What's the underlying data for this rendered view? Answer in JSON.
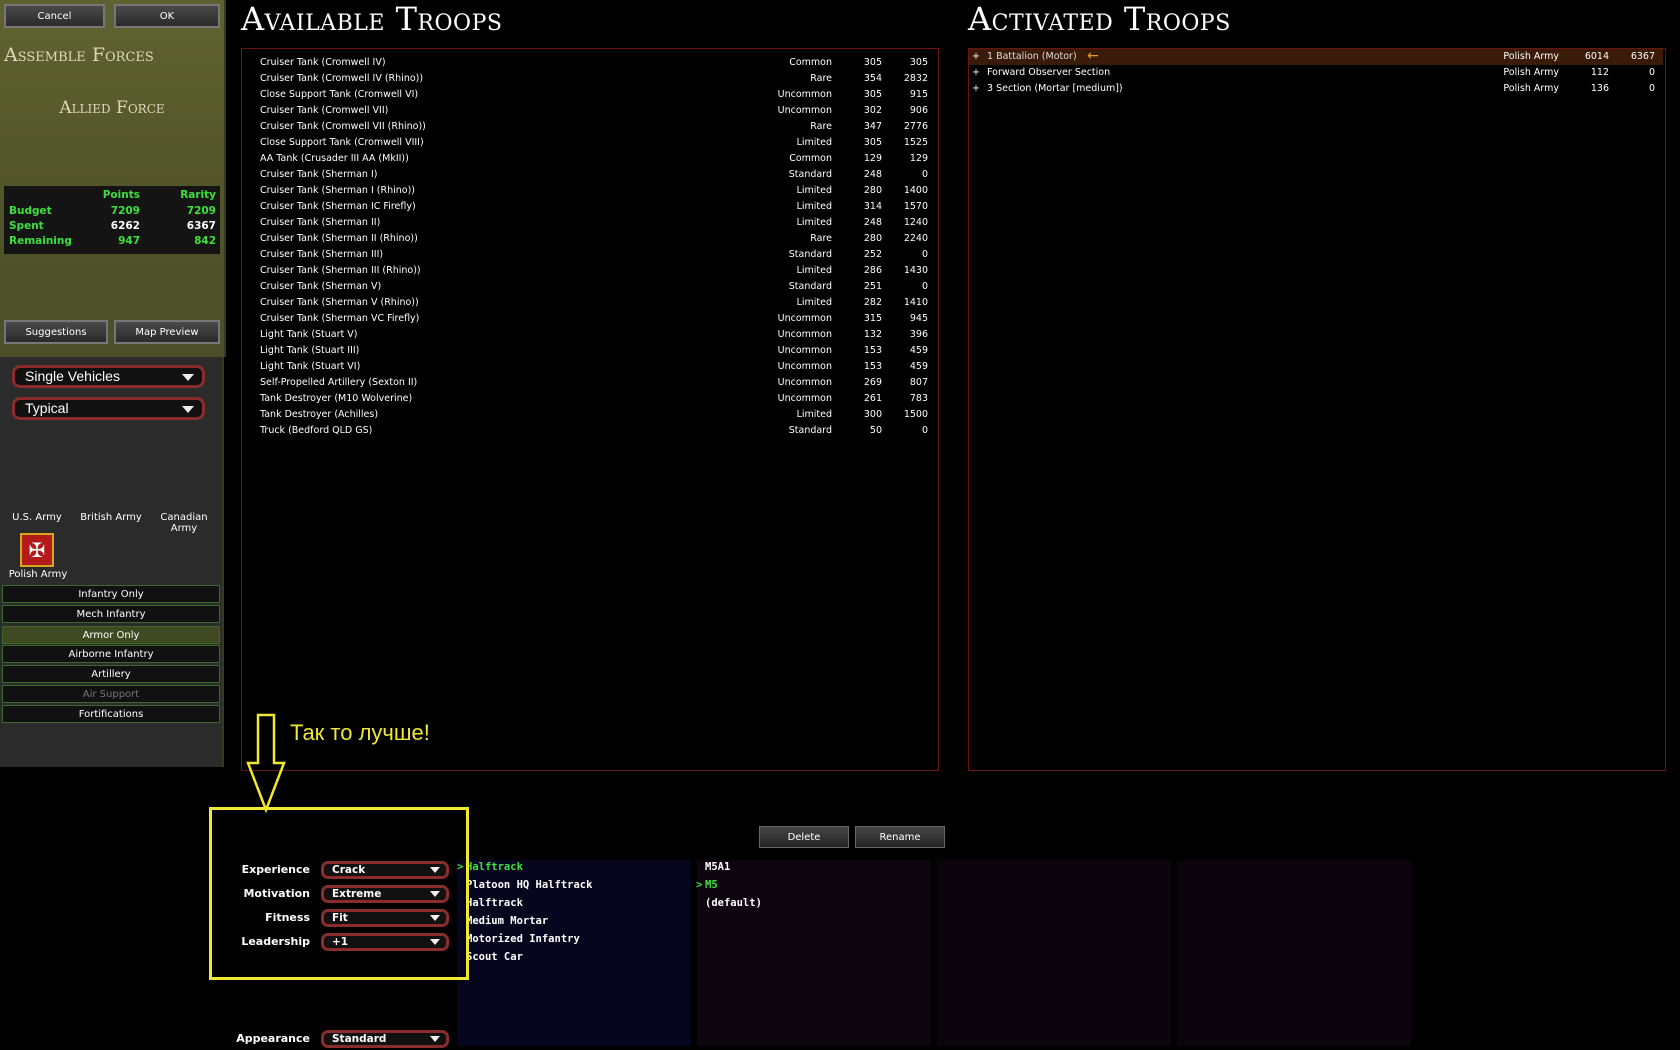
{
  "left": {
    "cancel_label": "Cancel",
    "ok_label": "OK",
    "title": "Assemble Forces",
    "force": "Allied Force",
    "budget": {
      "col_points": "Points",
      "col_rarity": "Rarity",
      "rows": [
        {
          "label": "Budget",
          "points": "7209",
          "rarity": "7209"
        },
        {
          "label": "Spent",
          "points": "6262",
          "rarity": "6367"
        },
        {
          "label": "Remaining",
          "points": "947",
          "rarity": "842"
        }
      ]
    },
    "suggestions_label": "Suggestions",
    "map_preview_label": "Map Preview",
    "purchase_type": "Single Vehicles",
    "quality": "Typical",
    "nations": [
      "U.S. Army",
      "British Army",
      "Canadian Army",
      "Polish Army"
    ],
    "filters": [
      "Infantry Only",
      "Mech Infantry",
      "Armor Only",
      "Airborne Infantry",
      "Artillery",
      "Air Support",
      "Fortifications"
    ]
  },
  "available": {
    "title": "Available Troops",
    "rows": [
      {
        "name": "Cruiser Tank (Cromwell IV)",
        "rarity": "Common",
        "cost": "305",
        "rcost": "305"
      },
      {
        "name": "Cruiser Tank (Cromwell IV (Rhino))",
        "rarity": "Rare",
        "cost": "354",
        "rcost": "2832"
      },
      {
        "name": "Close Support Tank (Cromwell VI)",
        "rarity": "Uncommon",
        "cost": "305",
        "rcost": "915"
      },
      {
        "name": "Cruiser Tank (Cromwell VII)",
        "rarity": "Uncommon",
        "cost": "302",
        "rcost": "906"
      },
      {
        "name": "Cruiser Tank (Cromwell VII (Rhino))",
        "rarity": "Rare",
        "cost": "347",
        "rcost": "2776"
      },
      {
        "name": "Close Support Tank (Cromwell VIII)",
        "rarity": "Limited",
        "cost": "305",
        "rcost": "1525"
      },
      {
        "name": "AA Tank (Crusader III AA (MkII))",
        "rarity": "Common",
        "cost": "129",
        "rcost": "129"
      },
      {
        "name": "Cruiser Tank (Sherman I)",
        "rarity": "Standard",
        "cost": "248",
        "rcost": "0"
      },
      {
        "name": "Cruiser Tank (Sherman I (Rhino))",
        "rarity": "Limited",
        "cost": "280",
        "rcost": "1400"
      },
      {
        "name": "Cruiser Tank (Sherman IC Firefly)",
        "rarity": "Limited",
        "cost": "314",
        "rcost": "1570"
      },
      {
        "name": "Cruiser Tank (Sherman II)",
        "rarity": "Limited",
        "cost": "248",
        "rcost": "1240"
      },
      {
        "name": "Cruiser Tank (Sherman II (Rhino))",
        "rarity": "Rare",
        "cost": "280",
        "rcost": "2240"
      },
      {
        "name": "Cruiser Tank (Sherman III)",
        "rarity": "Standard",
        "cost": "252",
        "rcost": "0"
      },
      {
        "name": "Cruiser Tank (Sherman III (Rhino))",
        "rarity": "Limited",
        "cost": "286",
        "rcost": "1430"
      },
      {
        "name": "Cruiser Tank (Sherman V)",
        "rarity": "Standard",
        "cost": "251",
        "rcost": "0"
      },
      {
        "name": "Cruiser Tank (Sherman V (Rhino))",
        "rarity": "Limited",
        "cost": "282",
        "rcost": "1410"
      },
      {
        "name": "Cruiser Tank (Sherman VC Firefly)",
        "rarity": "Uncommon",
        "cost": "315",
        "rcost": "945"
      },
      {
        "name": "Light Tank (Stuart V)",
        "rarity": "Uncommon",
        "cost": "132",
        "rcost": "396"
      },
      {
        "name": "Light Tank (Stuart III)",
        "rarity": "Uncommon",
        "cost": "153",
        "rcost": "459"
      },
      {
        "name": "Light Tank (Stuart VI)",
        "rarity": "Uncommon",
        "cost": "153",
        "rcost": "459"
      },
      {
        "name": "Self-Propelled Artillery (Sexton II)",
        "rarity": "Uncommon",
        "cost": "269",
        "rcost": "807"
      },
      {
        "name": "Tank Destroyer (M10 Wolverine)",
        "rarity": "Uncommon",
        "cost": "261",
        "rcost": "783"
      },
      {
        "name": "Tank Destroyer (Achilles)",
        "rarity": "Limited",
        "cost": "300",
        "rcost": "1500"
      },
      {
        "name": "Truck (Bedford QLD GS)",
        "rarity": "Standard",
        "cost": "50",
        "rcost": "0"
      }
    ]
  },
  "activated": {
    "title": "Activated Troops",
    "rows": [
      {
        "expand": "+",
        "name": "1 Battalion (Motor)",
        "army": "Polish Army",
        "cost": "6014",
        "rcost": "6367"
      },
      {
        "expand": "+",
        "name": "Forward Observer Section",
        "army": "Polish Army",
        "cost": "112",
        "rcost": "0"
      },
      {
        "expand": "+",
        "name": "3 Section (Mortar [medium])",
        "army": "Polish Army",
        "cost": "136",
        "rcost": "0"
      }
    ]
  },
  "actions": {
    "delete_label": "Delete",
    "rename_label": "Rename"
  },
  "attributes": [
    {
      "label": "Experience",
      "value": "Crack"
    },
    {
      "label": "Motivation",
      "value": "Extreme"
    },
    {
      "label": "Fitness",
      "value": "Fit"
    },
    {
      "label": "Leadership",
      "value": "+1"
    }
  ],
  "appearance": {
    "label": "Appearance",
    "value": "Standard"
  },
  "units": {
    "col1": [
      "Halftrack",
      "Platoon HQ Halftrack",
      "Halftrack",
      "Medium Mortar",
      "Motorized Infantry",
      "Scout Car"
    ],
    "col1_selected_marker": ">",
    "col2": [
      "M5A1",
      "M5",
      "(default)"
    ],
    "col2_selected_marker": ">"
  },
  "annotation": {
    "text": "Так то лучше!",
    "color": "#f0e832"
  },
  "colors": {
    "accent_green": "#3ee03e",
    "border_red": "#8a2c2c",
    "olive": "#5f6230"
  }
}
